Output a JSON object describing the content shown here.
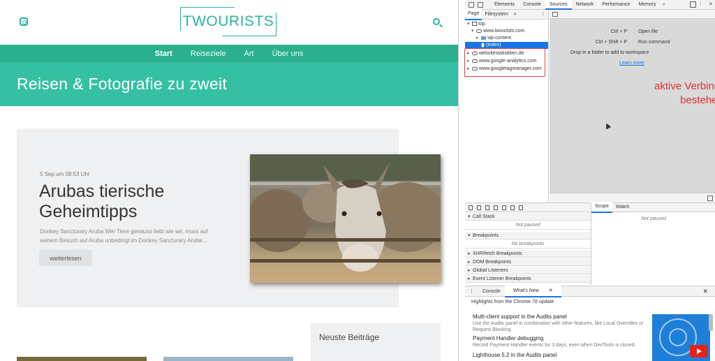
{
  "site": {
    "logo_text": "TWOURISTS",
    "nav": [
      "Start",
      "Reiseziele",
      "Art",
      "Über uns"
    ],
    "hero_title": "Reisen & Fotografie zu zweit",
    "post": {
      "date": "5 Sep um 08:53 Uhr",
      "title_line1": "Arubas tierische",
      "title_line2": "Geheimtipps",
      "excerpt": "Donkey Sancturary Aruba Wer Tiere genauso liebt wie wir, muss auf seinem Besuch auf Aruba unbedingt im Donkey Sancturary Aruba…",
      "read_more": "weiterlesen"
    },
    "widget_title": "Neuste Beiträge",
    "colors": {
      "accent": "#2bb3a0",
      "nav_bg": "#2bb08f",
      "hero_bg": "#36c0a3"
    }
  },
  "devtools": {
    "tabs": [
      "Elements",
      "Console",
      "Sources",
      "Network",
      "Performance",
      "Memory"
    ],
    "active_tab": "Sources",
    "more": "»",
    "close": "✕",
    "menu": "⋮",
    "navigator_tabs": [
      "Page",
      "Filesystem"
    ],
    "navigator_more": "»",
    "navigator_menu": "⋮",
    "tree": {
      "top": "top",
      "domain": "www.twourists.com",
      "folder": "wp-content",
      "file": "(index)",
      "connections": [
        "websitestatistiken.de",
        "www.google-analytics.com",
        "www.googletagmanager.com"
      ]
    },
    "shortcuts": [
      {
        "keys": "Ctrl + P",
        "action": "Open file"
      },
      {
        "keys": "Ctrl + Shift + P",
        "action": "Run command"
      }
    ],
    "drop_hint": "Drop in a folder to add to workspace",
    "learn_more": "Learn more",
    "annotation": "aktive Verbindungen bestehen",
    "scope_tabs": [
      "Scope",
      "Watch"
    ],
    "not_paused": "Not paused",
    "sections": [
      {
        "title": "Call Stack",
        "content": "Not paused"
      },
      {
        "title": "Breakpoints",
        "content": "No breakpoints"
      }
    ],
    "collapsed_sections": [
      "XHR/fetch Breakpoints",
      "DOM Breakpoints",
      "Global Listeners",
      "Event Listener Breakpoints"
    ],
    "drawer_tabs": [
      "Console",
      "What's New"
    ],
    "drawer_tab_close": "✕",
    "drawer_menu": "⋮",
    "drawer_close": "✕",
    "whats_new_heading": "Highlights from the Chrome 78 update",
    "whats_new": [
      {
        "title": "Multi-client support in the Audits panel",
        "desc": "Use the Audits panel in combination with other features, like Local Overrides or Request Blocking."
      },
      {
        "title": "Payment Handler debugging",
        "desc": "Record Payment Handler events for 3 days, even when DevTools is closed."
      },
      {
        "title": "Lighthouse 5.2 in the Audits panel",
        "desc": ""
      }
    ],
    "colors": {
      "selection": "#1a73e8",
      "annotation": "#e03030",
      "highlight_box": "#e04040"
    }
  }
}
